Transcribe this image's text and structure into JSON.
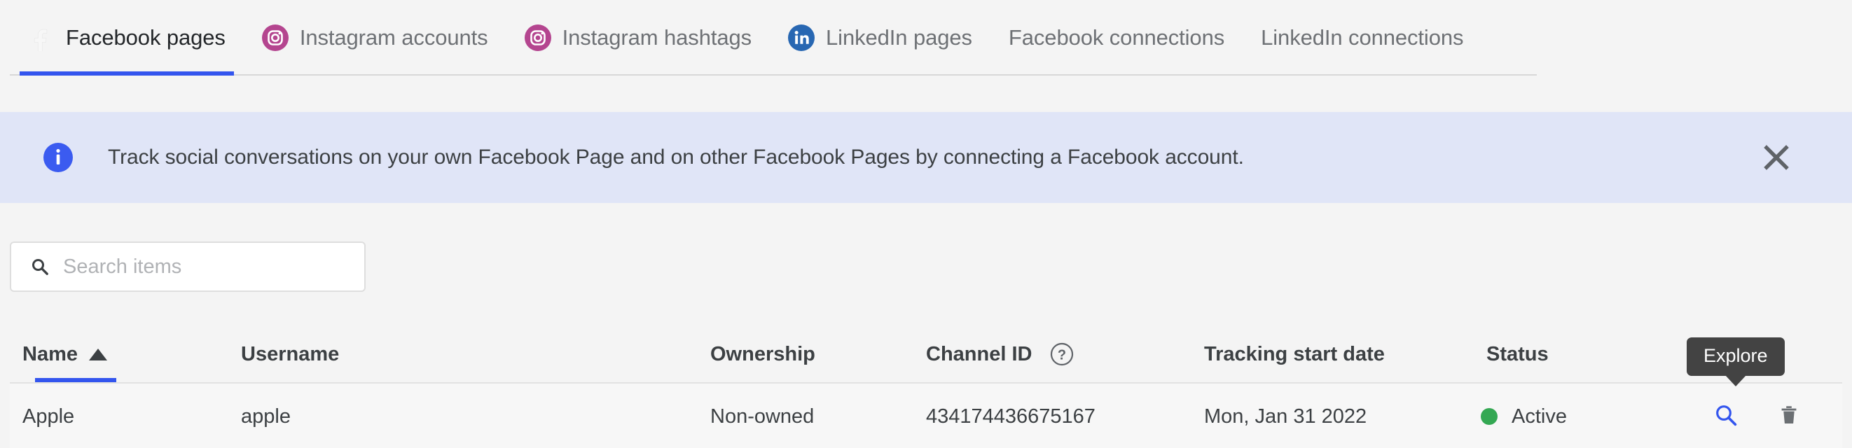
{
  "tabs": [
    {
      "label": "Facebook pages",
      "icon": "facebook-icon",
      "active": true
    },
    {
      "label": "Instagram accounts",
      "icon": "instagram-icon",
      "active": false
    },
    {
      "label": "Instagram hashtags",
      "icon": "instagram-icon",
      "active": false
    },
    {
      "label": "LinkedIn pages",
      "icon": "linkedin-icon",
      "active": false
    },
    {
      "label": "Facebook connections",
      "icon": "none",
      "active": false
    },
    {
      "label": "LinkedIn connections",
      "icon": "none",
      "active": false
    }
  ],
  "banner": {
    "icon": "info-icon",
    "message": "Track social conversations on your own Facebook Page and on other Facebook Pages by connecting a Facebook account.",
    "close_icon": "close-icon"
  },
  "search": {
    "icon": "search-icon",
    "value": "",
    "placeholder": "Search items"
  },
  "table": {
    "columns": [
      {
        "label": "Name",
        "sorted": true,
        "sort_direction": "asc",
        "help": false
      },
      {
        "label": "Username",
        "sorted": false,
        "sort_direction": "",
        "help": false
      },
      {
        "label": "Ownership",
        "sorted": false,
        "sort_direction": "",
        "help": false
      },
      {
        "label": "Channel ID",
        "sorted": false,
        "sort_direction": "",
        "help": true
      },
      {
        "label": "Tracking start date",
        "sorted": false,
        "sort_direction": "",
        "help": false
      },
      {
        "label": "Status",
        "sorted": false,
        "sort_direction": "",
        "help": false
      }
    ],
    "rows": [
      {
        "name": "Apple",
        "username": "apple",
        "ownership": "Non-owned",
        "channel_id": "434174436675167",
        "tracking_start_date": "Mon, Jan 31 2022",
        "status": "Active",
        "status_color": "#34a853",
        "explore_icon": "search-icon",
        "delete_icon": "trash-icon"
      }
    ]
  },
  "tooltip": {
    "text": "Explore"
  },
  "colors": {
    "page_background": "#f4f4f4",
    "accent_blue": "#3355ee",
    "banner_background": "#e0e5f7",
    "instagram": "#b4458f",
    "linkedin": "#2867b2",
    "status_active": "#34a853",
    "tooltip_background": "#434343"
  }
}
